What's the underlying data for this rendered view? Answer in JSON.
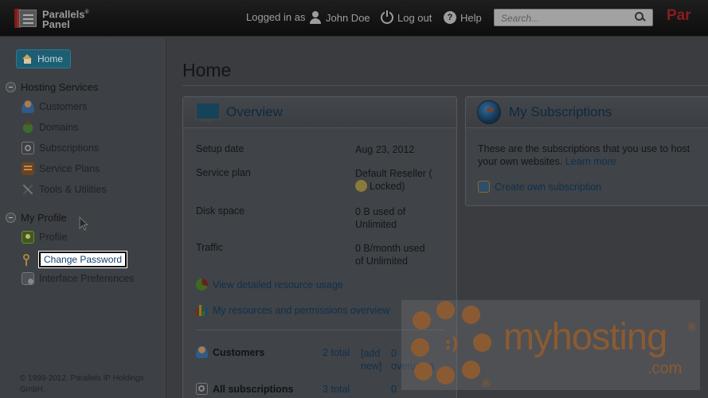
{
  "header": {
    "logo_line1": "Parallels",
    "logo_line2": "Panel",
    "logged_in_as": "Logged in as",
    "user_name": "John Doe",
    "logout": "Log out",
    "help": "Help",
    "search_placeholder": "Search...",
    "brand_edge": "Par"
  },
  "sidebar": {
    "home": "Home",
    "hosting_services": {
      "title": "Hosting Services",
      "items": [
        "Customers",
        "Domains",
        "Subscriptions",
        "Service Plans",
        "Tools & Utilities"
      ]
    },
    "my_profile": {
      "title": "My Profile",
      "items": [
        "Profile",
        "Change Password",
        "Interface Preferences"
      ]
    },
    "footer": "© 1999-2012. Parallels IP Holdings GmbH."
  },
  "main": {
    "title": "Home",
    "overview": {
      "title": "Overview",
      "rows": [
        {
          "label": "Setup date",
          "value": "Aug 23, 2012"
        },
        {
          "label": "Service plan",
          "value": "Default Reseller (",
          "value2": "Locked)"
        },
        {
          "label": "Disk space",
          "value": "0 B used of",
          "value2": "Unlimited"
        },
        {
          "label": "Traffic",
          "value": "0 B/month used",
          "value2": "of Unlimited"
        }
      ],
      "link_usage": "View detailed resource usage",
      "link_permissions": "My resources and permissions overview",
      "customers": {
        "label": "Customers",
        "total": "2 total",
        "add": "[add",
        "add2": "new]",
        "over": "0",
        "over_label": "overusing"
      },
      "all_subscriptions": {
        "label": "All subscriptions",
        "total": "3 total",
        "over": "0"
      }
    },
    "subscriptions": {
      "title": "My Subscriptions",
      "desc_line1": "These are the subscriptions that you use to host",
      "desc_line2": "your own websites.",
      "learn_more": "Learn more",
      "create_link": "Create own subscription"
    }
  },
  "watermark": {
    "text": "myhosting",
    "dotcom": ".com",
    "reg": "®",
    "smile": ":)"
  },
  "colors": {
    "accent": "#1d5e73",
    "watermark": "#8a5b32",
    "highlight_bg": "#ffffff"
  }
}
